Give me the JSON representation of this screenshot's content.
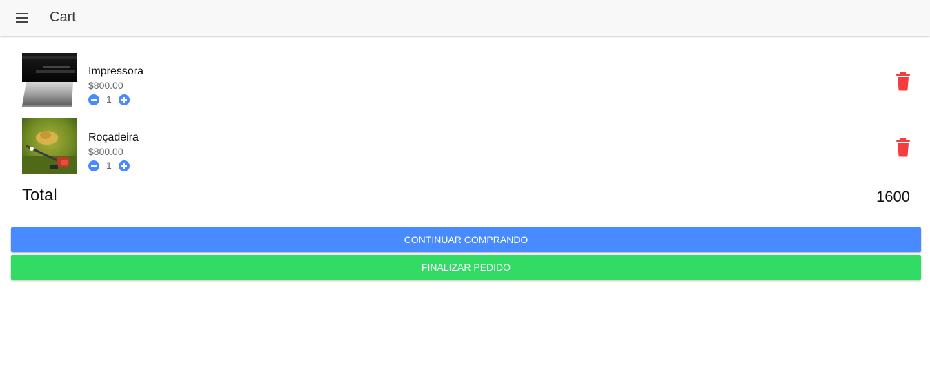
{
  "header": {
    "title": "Cart",
    "menu_icon": "menu-icon"
  },
  "cart": {
    "items": [
      {
        "name": "Impressora",
        "price": "$800.00",
        "quantity": "1",
        "image": "printer-photo"
      },
      {
        "name": "Roçadeira",
        "price": "$800.00",
        "quantity": "1",
        "image": "brush-cutter-photo"
      }
    ],
    "total_label": "Total",
    "total_value": "1600"
  },
  "actions": {
    "continue_label": "Continuar comprando",
    "finish_label": "Finalizar pedido"
  },
  "colors": {
    "primary": "#488aff",
    "secondary": "#32db64",
    "danger": "#f53d3d",
    "toolbar": "#f8f8f8"
  }
}
